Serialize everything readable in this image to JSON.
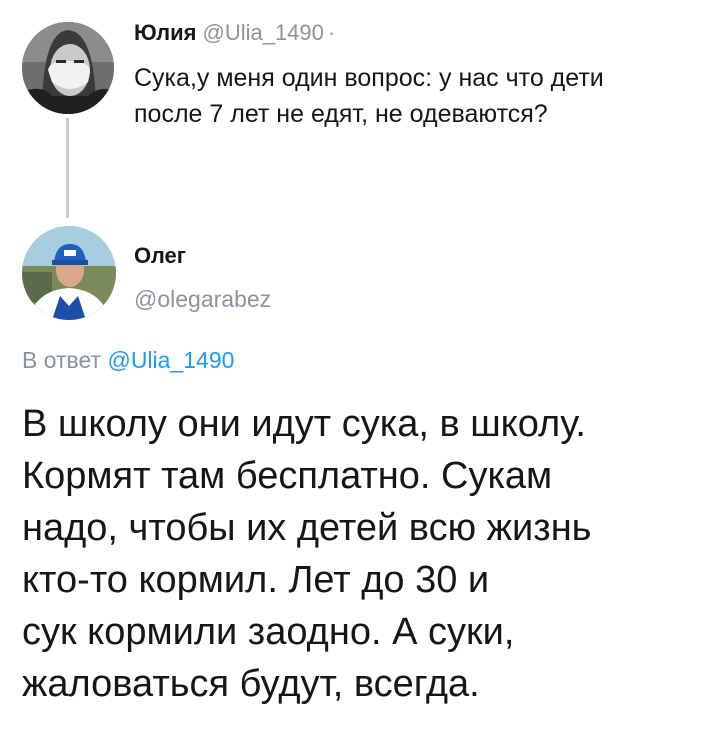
{
  "parent_tweet": {
    "name": "Юлия",
    "handle": "@Ulia_1490",
    "separator": "·",
    "text": "Сука,у меня один вопрос: у  нас что дети\nпосле 7 лет не едят, не одеваются?"
  },
  "reply_tweet": {
    "name": "Олег",
    "handle": "@olegarabez",
    "reply_to_label": "В ответ",
    "reply_to_handle": "@Ulia_1490",
    "text": "В школу они идут сука, в школу.\nКормят там бесплатно. Сукам\nнадо, чтобы их детей всю жизнь\nкто-то кормил. Лет до 30 и\nсук кормили заодно. А суки,\nжаловаться будут, всегда."
  },
  "colors": {
    "text": "#14171a",
    "muted": "#8a949d",
    "link": "#1d9bf0",
    "thread_line": "#c7cdd2"
  }
}
